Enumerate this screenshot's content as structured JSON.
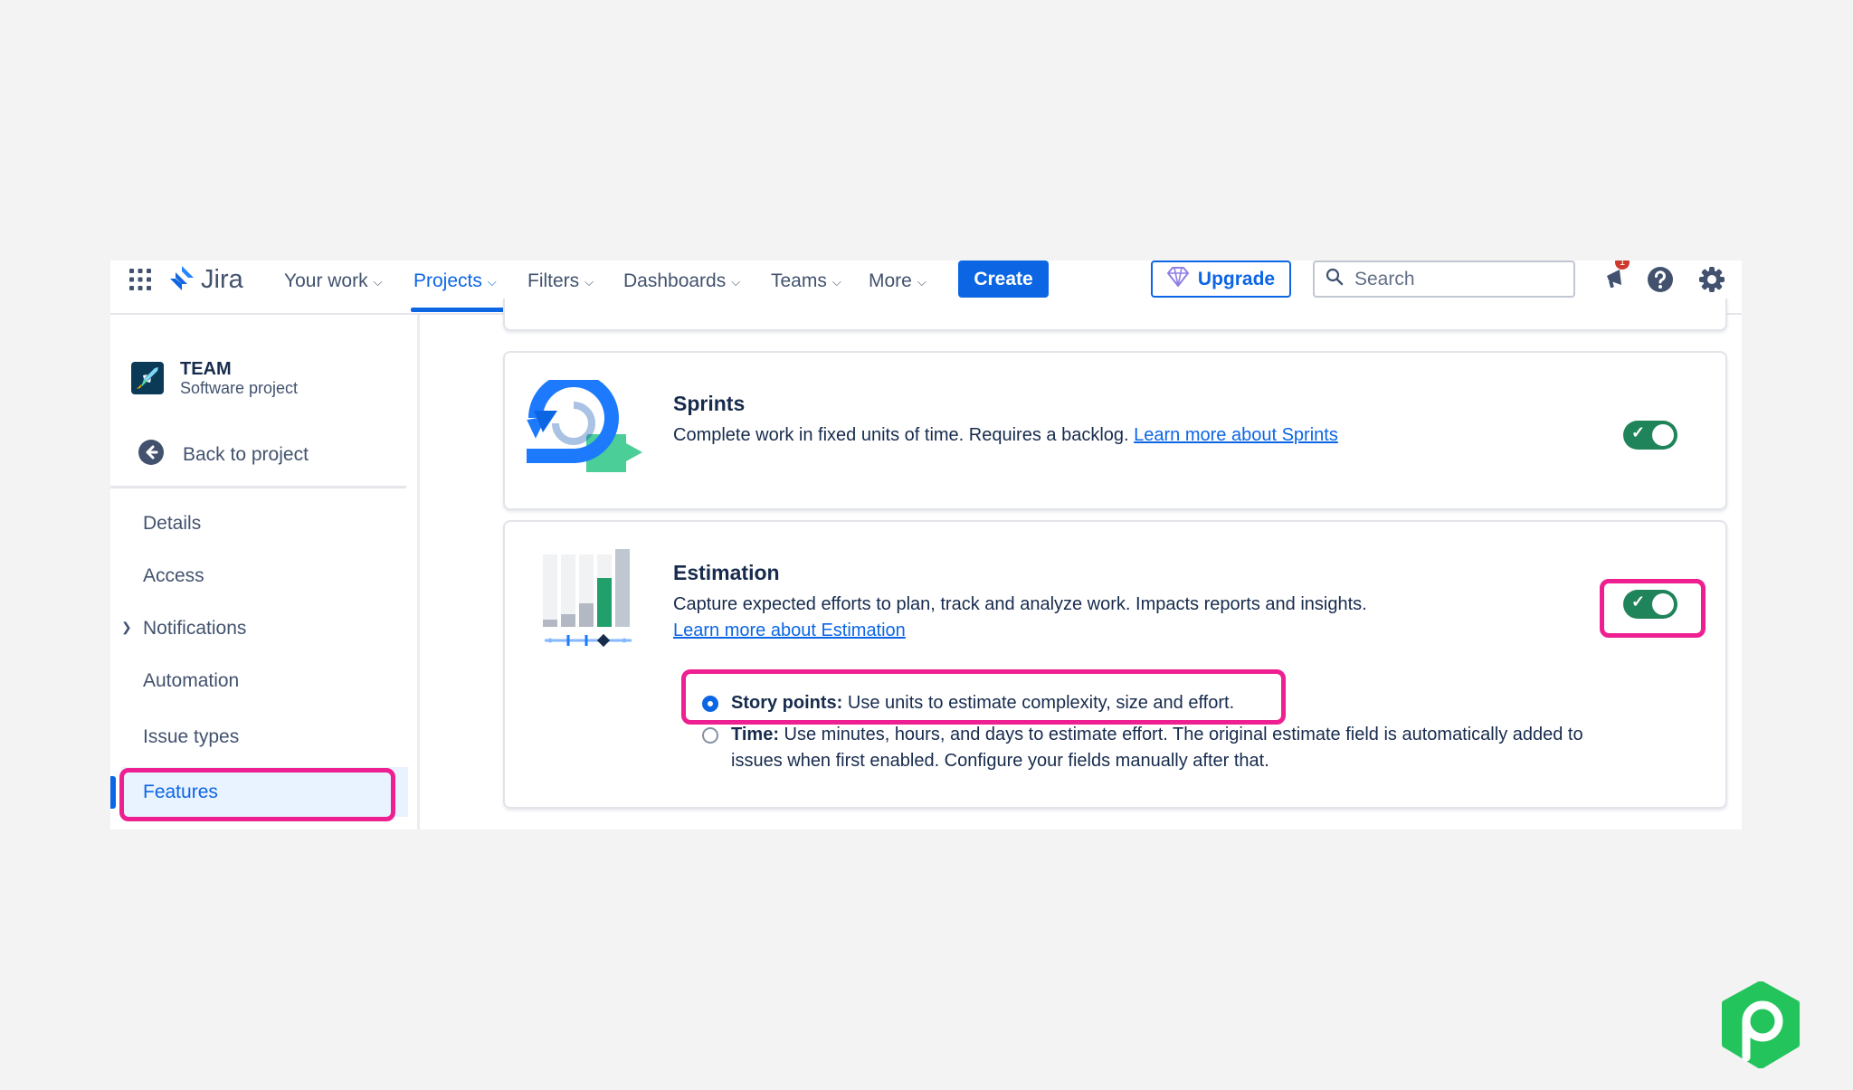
{
  "topnav": {
    "app_name": "Jira",
    "items": [
      {
        "label": "Your work"
      },
      {
        "label": "Projects",
        "active": true
      },
      {
        "label": "Filters"
      },
      {
        "label": "Dashboards"
      },
      {
        "label": "Teams"
      },
      {
        "label": "More"
      }
    ],
    "create_label": "Create",
    "upgrade_label": "Upgrade",
    "search_placeholder": "Search",
    "notification_count": "1",
    "icons": [
      "app-switcher-icon",
      "jira-logo-icon",
      "diamond-icon",
      "search-icon",
      "megaphone-icon",
      "help-icon",
      "settings-icon"
    ]
  },
  "sidebar": {
    "project_name": "TEAM",
    "project_type": "Software project",
    "back_label": "Back to project",
    "items": [
      {
        "label": "Details"
      },
      {
        "label": "Access"
      },
      {
        "label": "Notifications",
        "expandable": true
      },
      {
        "label": "Automation"
      },
      {
        "label": "Issue types"
      },
      {
        "label": "Features",
        "selected": true
      }
    ]
  },
  "features": {
    "sprints": {
      "title": "Sprints",
      "description": "Complete work in fixed units of time. Requires a backlog.",
      "link": "Learn more about Sprints",
      "enabled": true
    },
    "estimation": {
      "title": "Estimation",
      "description": "Capture expected efforts to plan, track and analyze work. Impacts reports and insights.",
      "link": "Learn more about Estimation",
      "enabled": true,
      "options": [
        {
          "label": "Story points:",
          "text": "Use units to estimate complexity, size and effort.",
          "selected": true
        },
        {
          "label": "Time:",
          "text": "Use minutes, hours, and days to estimate effort. The original estimate field is automatically added to issues when first enabled. Configure your fields manually after that.",
          "selected": false
        }
      ]
    }
  },
  "colors": {
    "accent": "#0c66e4",
    "toggle_on": "#1f845a",
    "highlight": "#ee1f91",
    "brand_badge": "#24c45c"
  }
}
